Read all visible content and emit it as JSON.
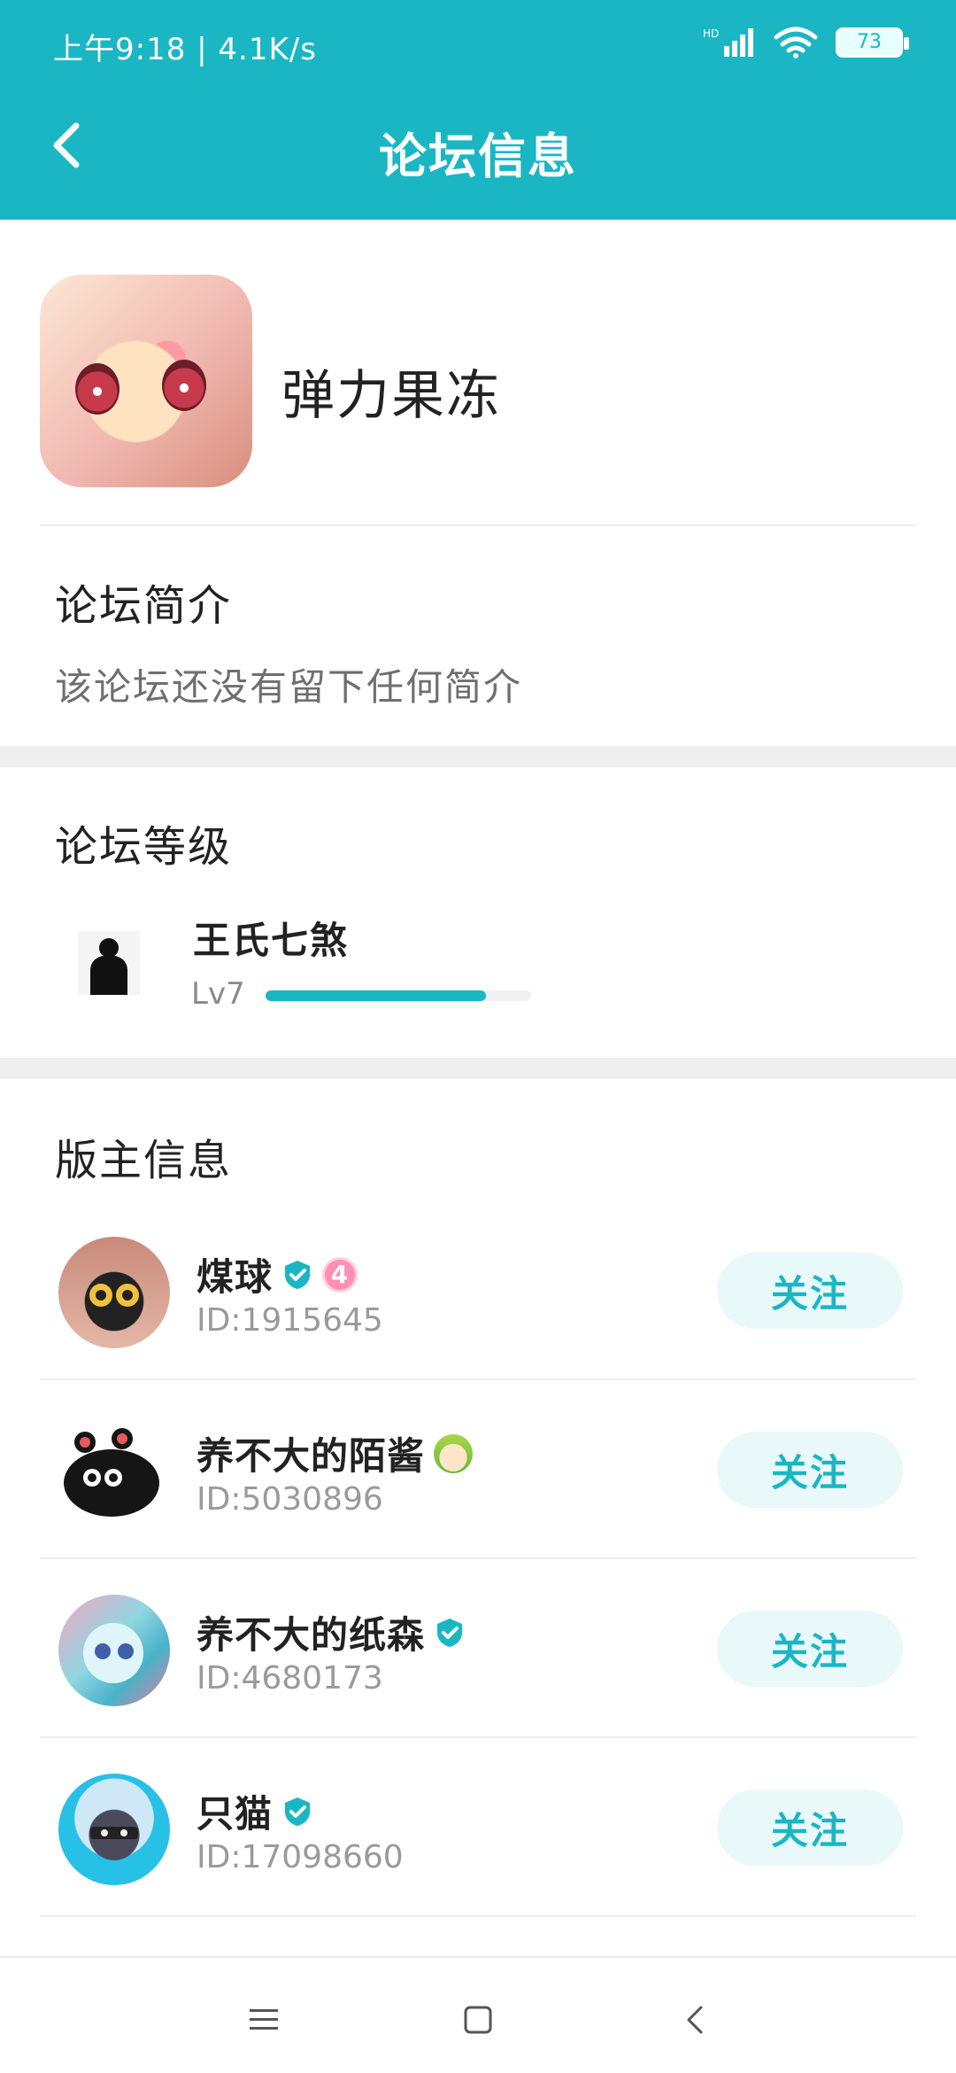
{
  "status_bar": {
    "time_info": "上午9:18 | 4.1K/s",
    "battery": "73"
  },
  "header": {
    "title": "论坛信息"
  },
  "forum": {
    "name": "弹力果冻"
  },
  "intro": {
    "title": "论坛简介",
    "text": "该论坛还没有留下任何简介"
  },
  "level": {
    "title": "论坛等级",
    "user_name": "王氏七煞",
    "level_tag": "Lv7",
    "progress": 0.83
  },
  "moderators": {
    "title": "版主信息",
    "follow_label": "关注",
    "items": [
      {
        "name": "煤球",
        "id": "ID:1915645",
        "badge_number": "4"
      },
      {
        "name": "养不大的陌酱",
        "id": "ID:5030896"
      },
      {
        "name": "养不大的纸森",
        "id": "ID:4680173"
      },
      {
        "name": "只猫",
        "id": "ID:17098660"
      }
    ]
  },
  "colors": {
    "accent": "#1bb6c4",
    "follow_bg": "#e9f8f9"
  },
  "icons": {
    "back": "chevron-left-icon",
    "verified": "verified-shield-icon",
    "nav_menu": "menu-icon",
    "nav_home": "square-home-icon",
    "nav_back": "triangle-back-icon"
  }
}
